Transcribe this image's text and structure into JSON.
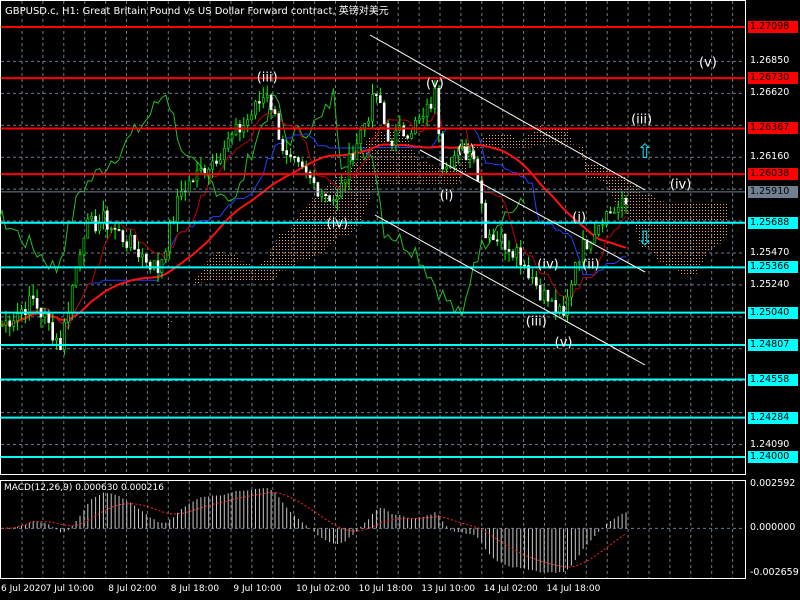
{
  "title": "GBPUSD.c, H1:  Great Britain Pound vs US Dollar Forward contract, 英镑对美元",
  "macd_title": "MACD(12,26,9) 0.000630 0.000216",
  "colors": {
    "red_level": "#ff0000",
    "cyan_level": "#00ffff",
    "grid": "#6a7a8a",
    "ma_red": "#ff1010",
    "ma_blue": "#2040ff",
    "chikou": "#20c020",
    "cloud": "#f4a070"
  },
  "price_axis": {
    "grid_labels": [
      "1.26850",
      "1.26620",
      "1.26160",
      "1.25470",
      "1.25240",
      "1.24090"
    ],
    "red_levels": [
      "1.27098",
      "1.26730",
      "1.26367",
      "1.26038"
    ],
    "cyan_levels": [
      "1.25688",
      "1.25366",
      "1.25040",
      "1.24807",
      "1.24558",
      "1.24284",
      "1.24000"
    ],
    "current_price": "1.25910"
  },
  "macd_axis": {
    "max": "0.002592",
    "zero": "0.000000",
    "min": "-0.002659"
  },
  "time_labels": [
    "6 Jul 2020",
    "7 Jul 10:00",
    "8 Jul 02:00",
    "8 Jul 18:00",
    "9 Jul 10:00",
    "10 Jul 02:00",
    "10 Jul 18:00",
    "13 Jul 10:00",
    "14 Jul 02:00",
    "14 Jul 18:00"
  ],
  "wave_labels": [
    {
      "text": "(iii)",
      "bar": 68,
      "price": 1.2673
    },
    {
      "text": "(v)",
      "bar": 111,
      "price": 1.2669
    },
    {
      "text": "(v)",
      "bar": 181,
      "price": 1.2684
    },
    {
      "text": "(iii)",
      "bar": 164,
      "price": 1.2643
    },
    {
      "text": "(iv)",
      "bar": 174,
      "price": 1.2596
    },
    {
      "text": "(ii)",
      "bar": 119,
      "price": 1.2621
    },
    {
      "text": "(i)",
      "bar": 114,
      "price": 1.2588
    },
    {
      "text": "(iv)",
      "bar": 86,
      "price": 1.2568
    },
    {
      "text": "(i)",
      "bar": 148,
      "price": 1.2572
    },
    {
      "text": "(ii)",
      "bar": 151,
      "price": 1.2538
    },
    {
      "text": "(iv)",
      "bar": 140,
      "price": 1.2538
    },
    {
      "text": "(iii)",
      "bar": 137,
      "price": 1.2497
    },
    {
      "text": "(v)",
      "bar": 144,
      "price": 1.2482
    }
  ],
  "chart_data": {
    "type": "candlestick",
    "symbol": "GBPUSD.c",
    "timeframe": "H1",
    "ylim": [
      1.239,
      1.272
    ],
    "close_path_anchors": [
      [
        0,
        1.2495
      ],
      [
        8,
        1.2513
      ],
      [
        15,
        1.2481
      ],
      [
        21,
        1.2564
      ],
      [
        26,
        1.2571
      ],
      [
        40,
        1.2535
      ],
      [
        46,
        1.2592
      ],
      [
        54,
        1.2614
      ],
      [
        63,
        1.2643
      ],
      [
        68,
        1.2664
      ],
      [
        73,
        1.2614
      ],
      [
        82,
        1.2592
      ],
      [
        86,
        1.2585
      ],
      [
        90,
        1.2621
      ],
      [
        96,
        1.2661
      ],
      [
        99,
        1.2628
      ],
      [
        108,
        1.2643
      ],
      [
        111,
        1.2661
      ],
      [
        113,
        1.2614
      ],
      [
        121,
        1.2621
      ],
      [
        124,
        1.2564
      ],
      [
        132,
        1.2549
      ],
      [
        138,
        1.252
      ],
      [
        144,
        1.2499
      ],
      [
        147,
        1.2542
      ],
      [
        154,
        1.2574
      ],
      [
        160,
        1.2582
      ]
    ]
  }
}
